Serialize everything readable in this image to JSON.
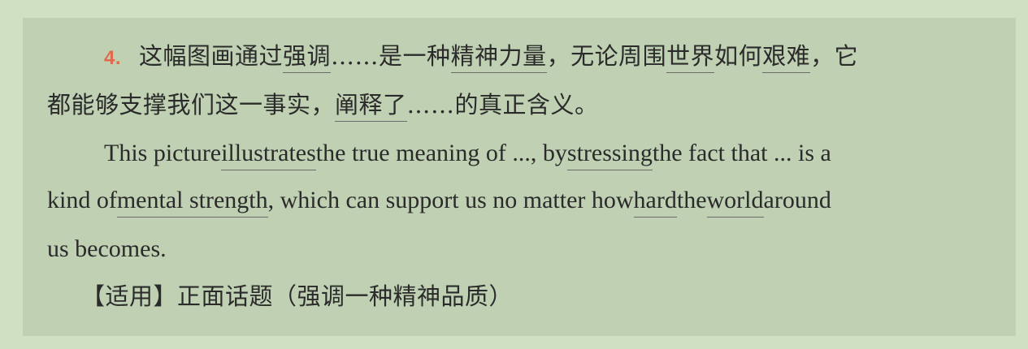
{
  "item_number": "4.",
  "cn": {
    "l1": {
      "t1": "这幅图画通过",
      "u1": "强调",
      "t2": "……是一种",
      "u2": "精神力量",
      "t3": "，无论周围",
      "u3": "世界",
      "t4": "如何",
      "u4": "艰难",
      "t5": "，它"
    },
    "l2": {
      "t1": "都能够支撑我们这一事实，",
      "u1": "阐释了",
      "t2": "……的真正含义。"
    }
  },
  "en": {
    "l1": {
      "t1": "This picture ",
      "u1": "illustrates",
      "t2": " the true meaning of ...,  by ",
      "u2": "stressing",
      "t3": " the fact that ... is a"
    },
    "l2": {
      "t1": "kind of ",
      "u1": "mental strength",
      "t2": ", which can support us no matter how ",
      "u2": "hard",
      "t3": " the ",
      "u3": "world",
      "t4": " around"
    },
    "l3": "us becomes."
  },
  "usage": {
    "label": "【适用】",
    "text": "正面话题（强调一种精神品质）"
  }
}
